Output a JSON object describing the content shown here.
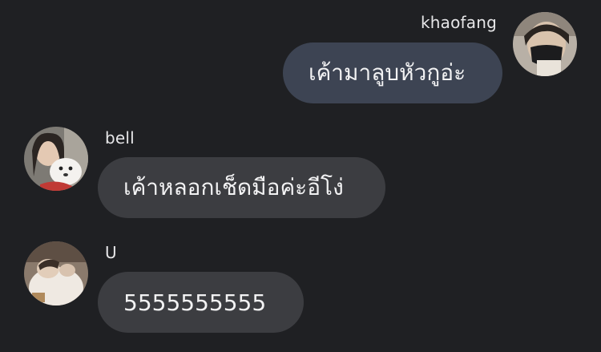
{
  "messages": [
    {
      "sender": "khaofang",
      "text": "เค้ามาลูบหัวกูอ่ะ",
      "direction": "outgoing"
    },
    {
      "sender": "bell",
      "text": "เค้าหลอกเช็ดมือค่ะอีโง่",
      "direction": "incoming"
    },
    {
      "sender": "U",
      "text": "5555555555",
      "direction": "incoming"
    }
  ],
  "colors": {
    "background": "#1f2023",
    "outgoing_bubble": "#3d4453",
    "incoming_bubble": "#3c3d41",
    "text": "#f2f2f3"
  }
}
